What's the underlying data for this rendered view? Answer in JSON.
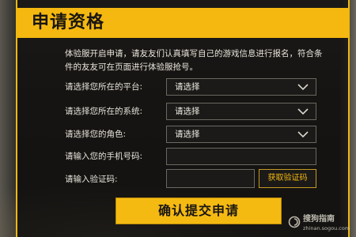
{
  "header": {
    "title": "申请资格"
  },
  "intro": "体验服开启申请，请友友们认真填写自己的游戏信息进行报名，符合条件的友友可在页面进行体验服抢号。",
  "form": {
    "platform": {
      "label": "请选择您所在的平台:",
      "value": "请选择"
    },
    "system": {
      "label": "请选择您所在的系统:",
      "value": "请选择"
    },
    "role": {
      "label": "请选择您的角色:",
      "value": "请选择"
    },
    "phone": {
      "label": "请输入您的手机号码:",
      "value": ""
    },
    "code": {
      "label": "请输入验证码:",
      "value": "",
      "button_label": "获取验证码"
    }
  },
  "submit_label": "确认提交申请",
  "watermark": {
    "name": "搜狗指南",
    "url": "zhinan.sogou.com"
  },
  "colors": {
    "accent": "#f4b810",
    "panel_bg": "#12110f",
    "text": "#e5e1d8"
  }
}
